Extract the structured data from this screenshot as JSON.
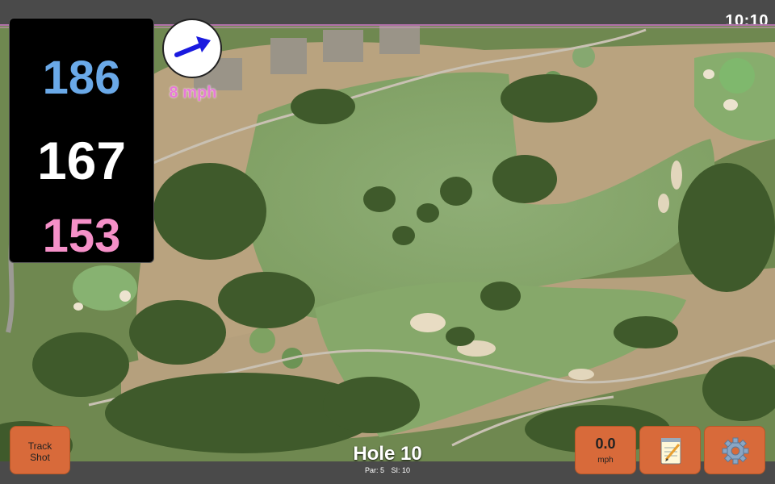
{
  "status": {
    "time": "10:10"
  },
  "distances": {
    "back": "186",
    "middle": "167",
    "front": "153"
  },
  "wind": {
    "speed_label": "8 mph",
    "icon": "wind-arrow-icon"
  },
  "hole": {
    "title": "Hole 10",
    "par_label": "Par: 5",
    "si_label": "SI: 10"
  },
  "buttons": {
    "track_shot": "Track Shot",
    "speed_value": "0.0",
    "speed_unit": "mph",
    "notes_icon": "notepad-icon",
    "settings_icon": "gear-icon"
  },
  "colors": {
    "back": "#6aa9e8",
    "middle": "#ffffff",
    "front": "#f590c8",
    "button": "#d86a3a",
    "wind_text": "#e87ad8"
  }
}
